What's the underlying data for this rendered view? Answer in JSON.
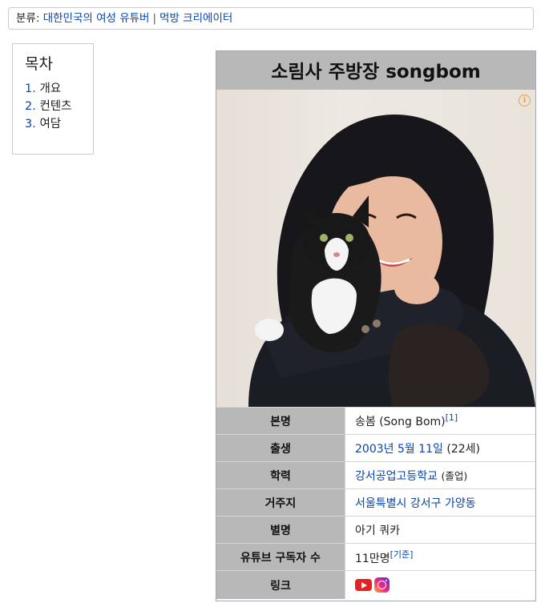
{
  "category_bar": {
    "label": "분류:",
    "items": [
      "대한민국의 여성 유튜버",
      "먹방 크리에이터"
    ],
    "separator": "|"
  },
  "toc": {
    "title": "목차",
    "items": [
      {
        "num": "1.",
        "label": "개요"
      },
      {
        "num": "2.",
        "label": "컨텐츠"
      },
      {
        "num": "3.",
        "label": "여담"
      }
    ]
  },
  "infobox": {
    "title": "소림사 주방장 songbom",
    "image_alt": "Woman in black jacket smiling, holding a black and white cat",
    "info_icon": "i",
    "rows": {
      "name": {
        "key": "본명",
        "value": "송봄 (Song Bom)",
        "ref": "[1]"
      },
      "birth": {
        "key": "출생",
        "date": "2003년 5월 11일",
        "age": "(22세)"
      },
      "education": {
        "key": "학력",
        "school": "강서공업고등학교",
        "status": "(졸업)"
      },
      "residence": {
        "key": "거주지",
        "value": "서울특별시 강서구 가양동"
      },
      "nickname": {
        "key": "별명",
        "value": "아기 쿼카"
      },
      "subscribers": {
        "key": "유튜브 구독자 수",
        "value": "11만명",
        "ref": "[기준]"
      },
      "links": {
        "key": "링크",
        "icons": [
          "youtube-icon",
          "instagram-icon"
        ]
      }
    }
  },
  "colors": {
    "link": "#0645ad",
    "header_bg": "#b8b8b8",
    "youtube": "#e52222",
    "info_icon": "#e8a23a"
  }
}
